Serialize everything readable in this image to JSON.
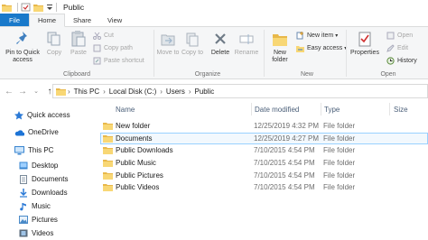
{
  "window": {
    "title": "Public"
  },
  "tabs": [
    "File",
    "Home",
    "Share",
    "View"
  ],
  "ribbon": {
    "clipboard": {
      "label": "Clipboard",
      "pin": "Pin to Quick access",
      "copy": "Copy",
      "paste": "Paste",
      "cut": "Cut",
      "copy_path": "Copy path",
      "paste_shortcut": "Paste shortcut"
    },
    "organize": {
      "label": "Organize",
      "move_to": "Move to",
      "copy_to": "Copy to",
      "delete": "Delete",
      "rename": "Rename"
    },
    "new": {
      "label": "New",
      "new_folder": "New folder",
      "new_item": "New item",
      "easy_access": "Easy access"
    },
    "open": {
      "label": "Open",
      "properties": "Properties",
      "open": "Open",
      "edit": "Edit",
      "history": "History"
    }
  },
  "address": {
    "breadcrumbs": [
      "This PC",
      "Local Disk (C:)",
      "Users",
      "Public"
    ]
  },
  "nav": {
    "quick_access": "Quick access",
    "onedrive": "OneDrive",
    "this_pc": "This PC",
    "items": [
      "Desktop",
      "Documents",
      "Downloads",
      "Music",
      "Pictures",
      "Videos"
    ]
  },
  "columns": {
    "name": "Name",
    "date": "Date modified",
    "type": "Type",
    "size": "Size"
  },
  "files": [
    {
      "name": "New folder",
      "date": "12/25/2019 4:32 PM",
      "type": "File folder"
    },
    {
      "name": "Documents",
      "date": "12/25/2019 4:27 PM",
      "type": "File folder"
    },
    {
      "name": "Public Downloads",
      "date": "7/10/2015 4:54 PM",
      "type": "File folder"
    },
    {
      "name": "Public Music",
      "date": "7/10/2015 4:54 PM",
      "type": "File folder"
    },
    {
      "name": "Public Pictures",
      "date": "7/10/2015 4:54 PM",
      "type": "File folder"
    },
    {
      "name": "Public Videos",
      "date": "7/10/2015 4:54 PM",
      "type": "File folder"
    }
  ]
}
